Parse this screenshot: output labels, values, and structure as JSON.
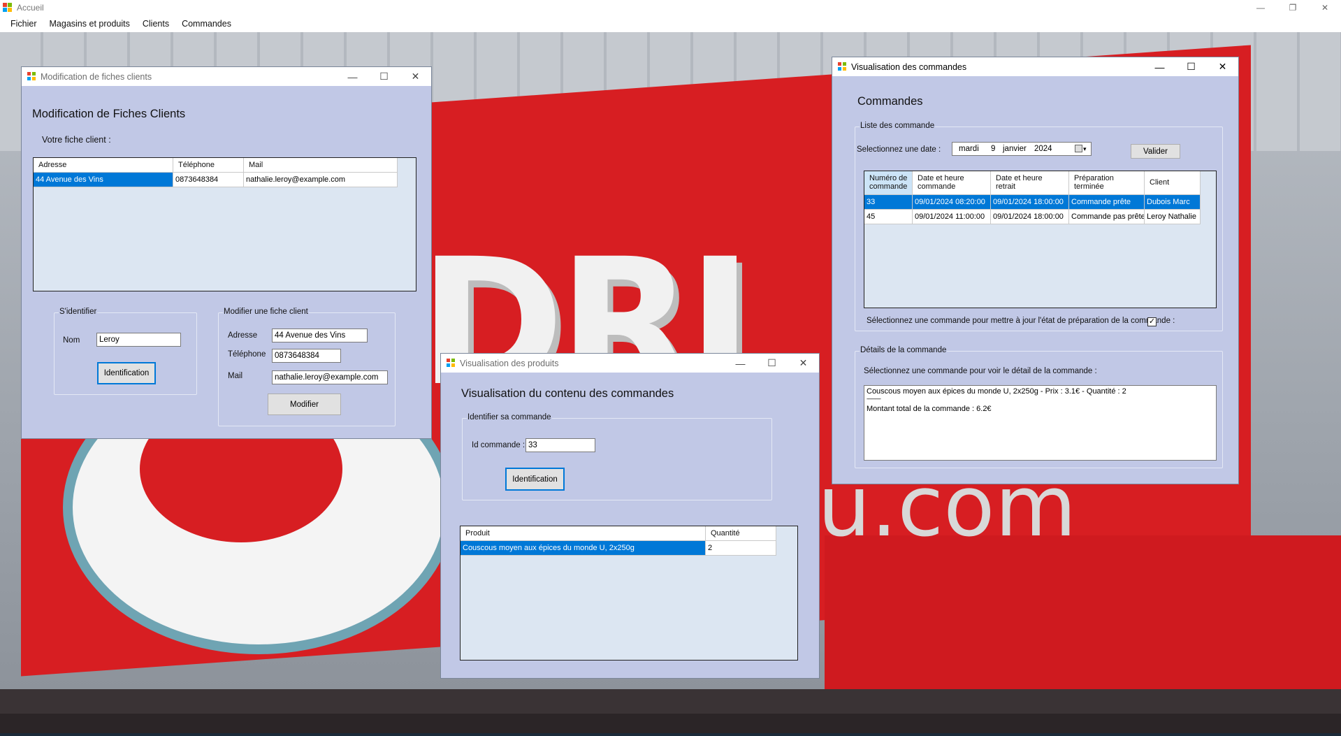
{
  "app": {
    "title": "Accueil",
    "menu": [
      "Fichier",
      "Magasins et produits",
      "Clients",
      "Commandes"
    ]
  },
  "clients_window": {
    "title": "Modification de fiches clients",
    "heading": "Modification de Fiches Clients",
    "subheading": "Votre fiche client :",
    "grid": {
      "columns": [
        "Adresse",
        "Téléphone",
        "Mail"
      ],
      "rows": [
        [
          "44 Avenue des Vins",
          "0873648384",
          "nathalie.leroy@example.com"
        ]
      ]
    },
    "identify_group": {
      "title": "S'identifier",
      "nom_label": "Nom",
      "nom_value": "Leroy",
      "button": "Identification"
    },
    "modify_group": {
      "title": "Modifier une fiche client",
      "adresse_label": "Adresse",
      "adresse_value": "44 Avenue des Vins",
      "telephone_label": "Téléphone",
      "telephone_value": "0873648384",
      "mail_label": "Mail",
      "mail_value": "nathalie.leroy@example.com",
      "button": "Modifier"
    }
  },
  "products_window": {
    "title": "Visualisation des produits",
    "heading": "Visualisation du contenu des commandes",
    "group_title": "Identifier sa commande",
    "id_label": "Id commande :",
    "id_value": "33",
    "button": "Identification",
    "grid": {
      "columns": [
        "Produit",
        "Quantité"
      ],
      "rows": [
        [
          "Couscous moyen aux épices du monde U, 2x250g",
          "2"
        ]
      ]
    }
  },
  "orders_window": {
    "title": "Visualisation des commandes",
    "heading": "Commandes",
    "list_group_title": "Liste des commande",
    "date_label": "Selectionnez une date :",
    "date_day": "mardi",
    "date_num": "9",
    "date_month": "janvier",
    "date_year": "2024",
    "valider_button": "Valider",
    "grid": {
      "columns": [
        [
          "Numéro de",
          "commande"
        ],
        [
          "Date et heure",
          "commande"
        ],
        [
          "Date et heure",
          "retrait"
        ],
        [
          "Préparation",
          "terminée"
        ],
        [
          "Client",
          ""
        ]
      ],
      "rows": [
        [
          "33",
          "09/01/2024 08:20:00",
          "09/01/2024 18:00:00",
          "Commande prête",
          "Dubois Marc"
        ],
        [
          "45",
          "09/01/2024 11:00:00",
          "09/01/2024 18:00:00",
          "Commande pas prête",
          "Leroy Nathalie"
        ]
      ]
    },
    "update_label": "Sélectionnez une commande pour mettre à jour l'état de préparation de la commande :",
    "update_checked": true,
    "details_group_title": "Détails de la commande",
    "details_label": "Sélectionnez une commande pour voir le détail de la commande :",
    "details_lines": [
      "Couscous moyen aux épices du monde U, 2x250g - Prix : 3.1€ - Quantité : 2",
      "------------",
      "Montant total de la commande : 6.2€"
    ]
  },
  "background": {
    "sign_text": "u.com"
  },
  "colors": {
    "window_bg": "#c1c8e6",
    "selection": "#0078d7",
    "brand_red": "#d71e22"
  }
}
